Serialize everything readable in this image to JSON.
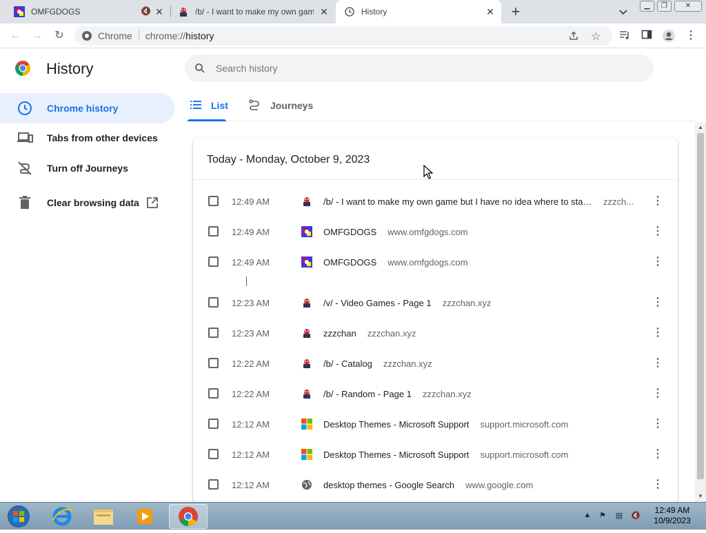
{
  "tabs": [
    {
      "title": "OMFGDOGS",
      "muted": true
    },
    {
      "title": "/b/ - I want to make my own game"
    },
    {
      "title": "History",
      "active": true
    }
  ],
  "toolbar": {
    "site_label": "Chrome",
    "url_prefix": "chrome://",
    "url_path": "history"
  },
  "page": {
    "title": "History",
    "search_placeholder": "Search history"
  },
  "sidebar": {
    "items": [
      {
        "label": "Chrome history",
        "selected": true
      },
      {
        "label": "Tabs from other devices"
      },
      {
        "label": "Turn off Journeys"
      },
      {
        "label": "Clear browsing data"
      }
    ]
  },
  "view_tabs": [
    {
      "label": "List",
      "selected": true
    },
    {
      "label": "Journeys"
    }
  ],
  "history": {
    "date_header": "Today - Monday, October 9, 2023",
    "rows": [
      {
        "time": "12:49 AM",
        "title": "/b/ - I want to make my own game but I have no idea where to star...",
        "domain": "zzzch...",
        "favicon": "zzzchan-icon"
      },
      {
        "time": "12:49 AM",
        "title": "OMFGDOGS",
        "domain": "www.omfgdogs.com",
        "favicon": "omfgdogs-icon"
      },
      {
        "time": "12:49 AM",
        "title": "OMFGDOGS",
        "domain": "www.omfgdogs.com",
        "favicon": "omfgdogs-icon"
      },
      {
        "time": "12:23 AM",
        "title": "/v/ - Video Games - Page 1",
        "domain": "zzzchan.xyz",
        "favicon": "zzzchan-icon"
      },
      {
        "time": "12:23 AM",
        "title": "zzzchan",
        "domain": "zzzchan.xyz",
        "favicon": "zzzchan-icon"
      },
      {
        "time": "12:22 AM",
        "title": "/b/ - Catalog",
        "domain": "zzzchan.xyz",
        "favicon": "zzzchan-icon"
      },
      {
        "time": "12:22 AM",
        "title": "/b/ - Random - Page 1",
        "domain": "zzzchan.xyz",
        "favicon": "zzzchan-icon"
      },
      {
        "time": "12:12 AM",
        "title": "Desktop Themes - Microsoft Support",
        "domain": "support.microsoft.com",
        "favicon": "microsoft-icon"
      },
      {
        "time": "12:12 AM",
        "title": "Desktop Themes - Microsoft Support",
        "domain": "support.microsoft.com",
        "favicon": "microsoft-icon"
      },
      {
        "time": "12:12 AM",
        "title": "desktop themes - Google Search",
        "domain": "www.google.com",
        "favicon": "globe-icon"
      }
    ]
  },
  "taskbar": {
    "time": "12:49 AM",
    "date": "10/9/2023"
  },
  "colors": {
    "accent": "#1a73e8",
    "selected_bg": "#e8f0fe",
    "tab_strip": "#dee1e6"
  }
}
